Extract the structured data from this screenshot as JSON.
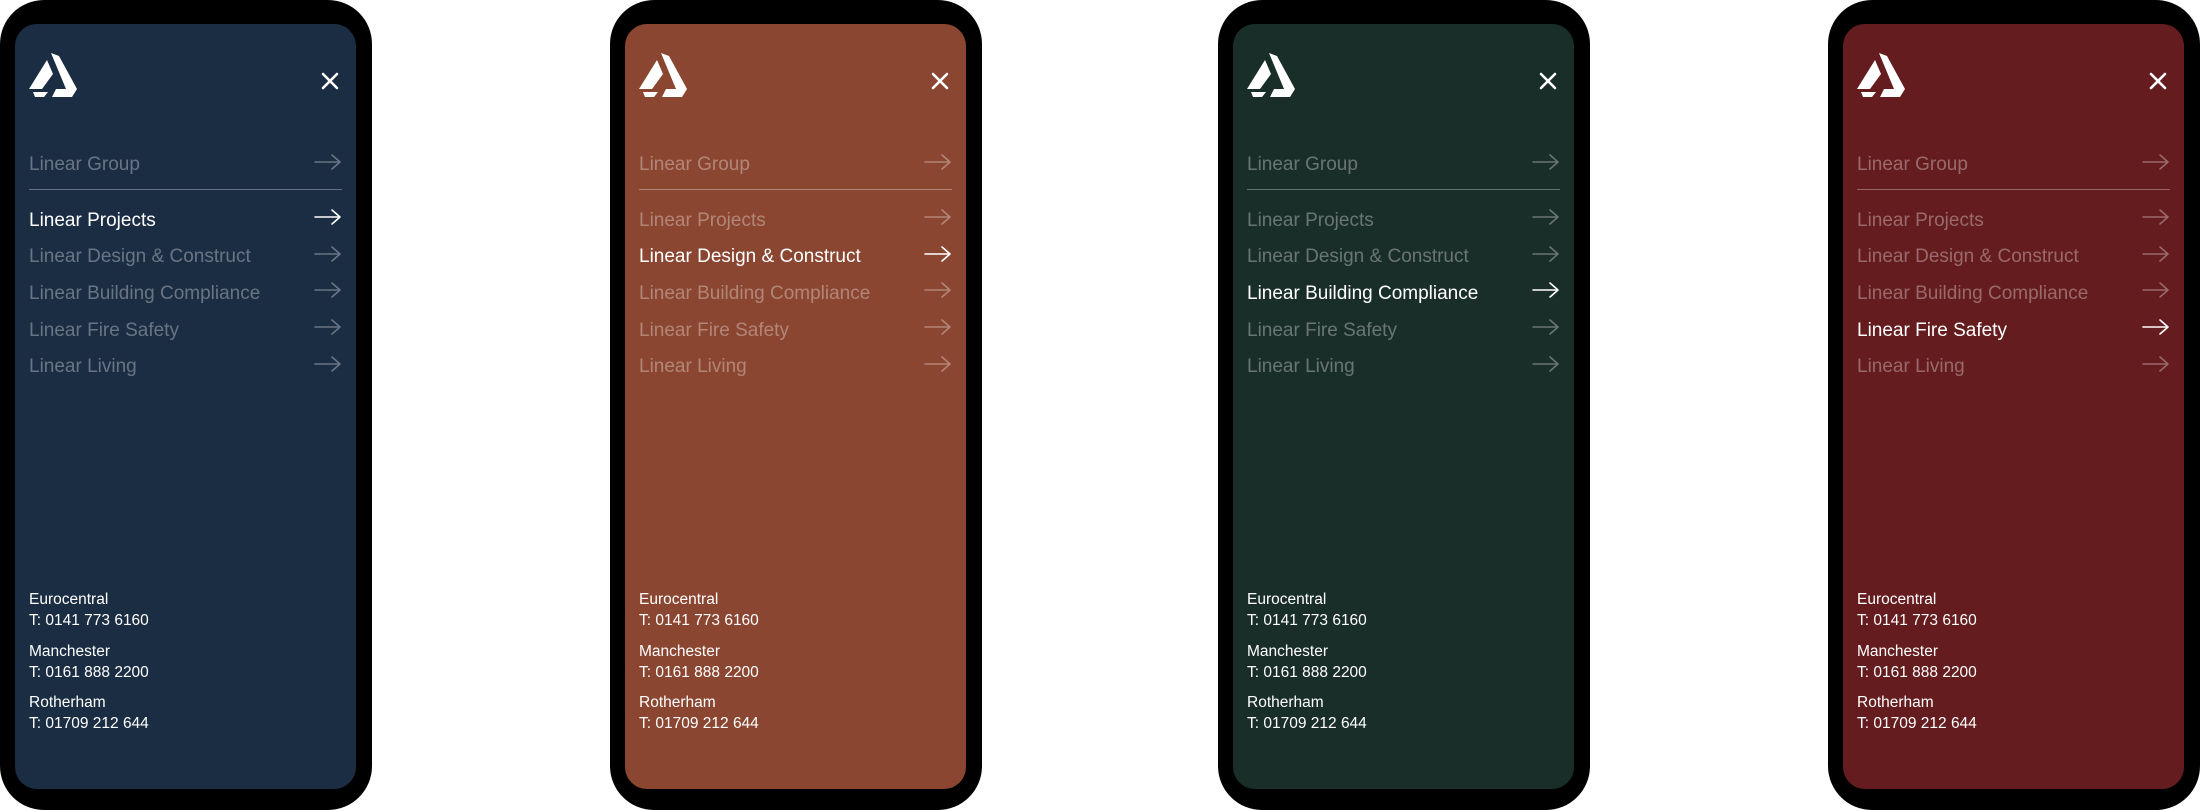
{
  "theme_colors": [
    "#1b2d43",
    "#8b4631",
    "#1a2e29",
    "#641c1e"
  ],
  "icons": {
    "logo": "linear-logo-icon",
    "close": "close-icon",
    "arrow": "arrow-right-icon"
  },
  "menu": {
    "group_label": "Linear Group",
    "items": [
      "Linear Projects",
      "Linear Design & Construct",
      "Linear Building Compliance",
      "Linear Fire Safety",
      "Linear Living"
    ]
  },
  "offices": [
    {
      "name": "Eurocentral",
      "phone": "T: 0141 773 6160"
    },
    {
      "name": "Manchester",
      "phone": "T: 0161 888 2200"
    },
    {
      "name": "Rotherham",
      "phone": "T: 01709 212 644"
    }
  ],
  "screens": [
    {
      "active_item": "Linear Projects",
      "background": "#1b2d43"
    },
    {
      "active_item": "Linear Design & Construct",
      "background": "#8b4631"
    },
    {
      "active_item": "Linear Building Compliance",
      "background": "#1a2e29"
    },
    {
      "active_item": "Linear Fire Safety",
      "background": "#641c1e"
    }
  ]
}
